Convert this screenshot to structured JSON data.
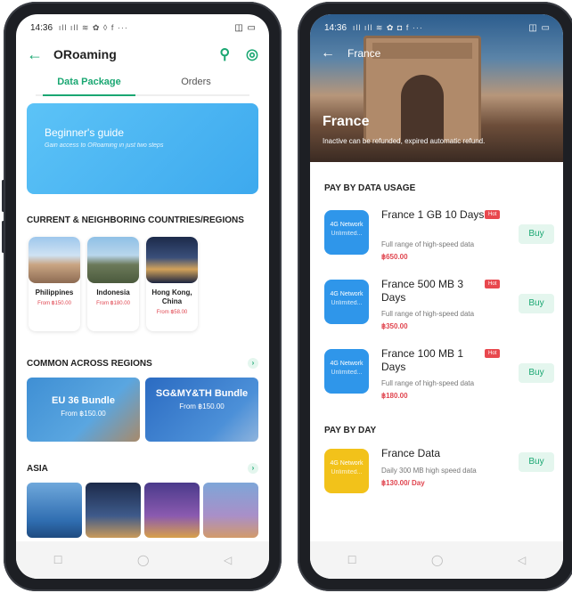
{
  "left": {
    "status": {
      "time": "14:36",
      "icons": "ıll ıll ≋ ✿ ◊ f ···",
      "right": "◫ ▭"
    },
    "appbar": {
      "title": "ORoaming"
    },
    "tabs": [
      {
        "label": "Data Package",
        "active": true
      },
      {
        "label": "Orders",
        "active": false
      }
    ],
    "banner": {
      "title": "Beginner's guide",
      "subtitle": "Gain access to ORoaming in just two steps"
    },
    "sections": {
      "current": "CURRENT & NEIGHBORING COUNTRIES/REGIONS",
      "common": "COMMON ACROSS REGIONS",
      "asia": "ASIA"
    },
    "countries": [
      {
        "name": "Philippines",
        "price": "From ฿150.00"
      },
      {
        "name": "Indonesia",
        "price": "From ฿180.00"
      },
      {
        "name": "Hong Kong, China",
        "price": "From ฿58.00"
      }
    ],
    "bundles": [
      {
        "name": "EU 36 Bundle",
        "price": "From ฿150.00"
      },
      {
        "name": "SG&MY&TH Bundle",
        "price": "From ฿150.00"
      }
    ],
    "nav": {
      "recent": "☐",
      "home": "◯",
      "back": "◁"
    }
  },
  "right": {
    "status": {
      "time": "14:36",
      "icons": "ıll ıll ≋ ✿ ◘ f ···",
      "right": "◫ ▭"
    },
    "appbar": {
      "title": "France"
    },
    "hero": {
      "title": "France",
      "note": "Inactive can be refunded, expired automatic refund."
    },
    "sections": {
      "usage": "PAY BY DATA USAGE",
      "day": "PAY BY DAY"
    },
    "packages": [
      {
        "title": "France 1 GB 10 Days",
        "hot": "Hot",
        "desc": "Full range of high-speed data",
        "price": "฿650.00",
        "buy": "Buy",
        "icon_l1": "4G Network",
        "icon_l2": "Unlimited..."
      },
      {
        "title": "France 500 MB 3 Days",
        "hot": "Hot",
        "desc": "Full range of high-speed data",
        "price": "฿350.00",
        "buy": "Buy",
        "icon_l1": "4G Network",
        "icon_l2": "Unlimited..."
      },
      {
        "title": "France 100 MB 1 Days",
        "hot": "Hot",
        "desc": "Full range of high-speed data",
        "price": "฿180.00",
        "buy": "Buy",
        "icon_l1": "4G Network",
        "icon_l2": "Unlimited..."
      }
    ],
    "day_package": {
      "title": "France Data",
      "desc": "Daily 300 MB high speed data",
      "price": "฿130.00/ Day",
      "buy": "Buy",
      "icon_l1": "4G Network",
      "icon_l2": "Unlimited..."
    },
    "nav": {
      "recent": "☐",
      "home": "◯",
      "back": "◁"
    }
  },
  "colors": {
    "accent": "#1aa772",
    "hot": "#e8484e",
    "price": "#e0454f",
    "blue_icon": "#2f96ea",
    "yellow_icon": "#f2c21a"
  }
}
